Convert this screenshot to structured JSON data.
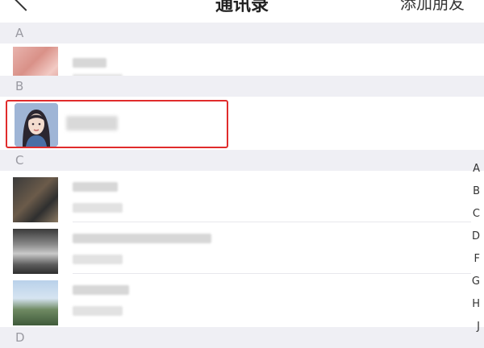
{
  "header": {
    "title": "通讯录",
    "add_friends_label": "添加朋友"
  },
  "sections": [
    {
      "letter": "A"
    },
    {
      "letter": "B"
    },
    {
      "letter": "C"
    },
    {
      "letter": "D"
    }
  ],
  "index_letters": [
    "A",
    "B",
    "C",
    "D",
    "F",
    "G",
    "H",
    "J"
  ],
  "accent": {
    "highlight_border": "#e02c2c"
  }
}
